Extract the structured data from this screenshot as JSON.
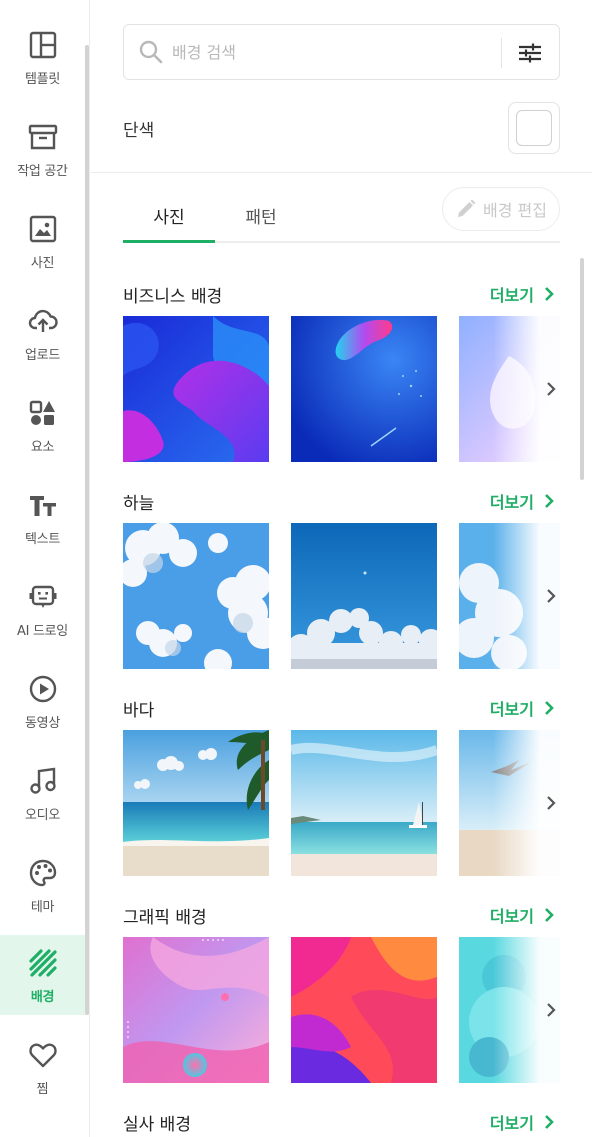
{
  "rail": {
    "items": [
      {
        "label": "템플릿",
        "icon": "layout-icon"
      },
      {
        "label": "작업 공간",
        "icon": "archive-box-icon"
      },
      {
        "label": "사진",
        "icon": "photo-icon"
      },
      {
        "label": "업로드",
        "icon": "cloud-upload-icon"
      },
      {
        "label": "요소",
        "icon": "shapes-icon"
      },
      {
        "label": "텍스트",
        "icon": "text-tt-icon"
      },
      {
        "label": "AI 드로잉",
        "icon": "robot-icon"
      },
      {
        "label": "동영상",
        "icon": "play-circle-icon"
      },
      {
        "label": "오디오",
        "icon": "music-note-icon"
      },
      {
        "label": "테마",
        "icon": "palette-icon"
      },
      {
        "label": "배경",
        "icon": "diagonal-lines-icon",
        "active": true
      },
      {
        "label": "찜",
        "icon": "heart-icon"
      }
    ]
  },
  "search": {
    "placeholder": "배경 검색"
  },
  "solid": {
    "label": "단색",
    "swatch_color": "#ffffff"
  },
  "tabs": [
    {
      "label": "사진",
      "active": true
    },
    {
      "label": "패턴",
      "active": false
    }
  ],
  "edit_button": {
    "label": "배경 편집"
  },
  "sections": [
    {
      "title": "비즈니스 배경",
      "more": "더보기"
    },
    {
      "title": "하늘",
      "more": "더보기"
    },
    {
      "title": "바다",
      "more": "더보기"
    },
    {
      "title": "그래픽 배경",
      "more": "더보기"
    },
    {
      "title": "실사 배경",
      "more": "더보기"
    }
  ],
  "colors": {
    "accent": "#1fae66",
    "active_bg": "#e3f6ec",
    "text": "#222222",
    "muted": "#b8b8b8"
  }
}
